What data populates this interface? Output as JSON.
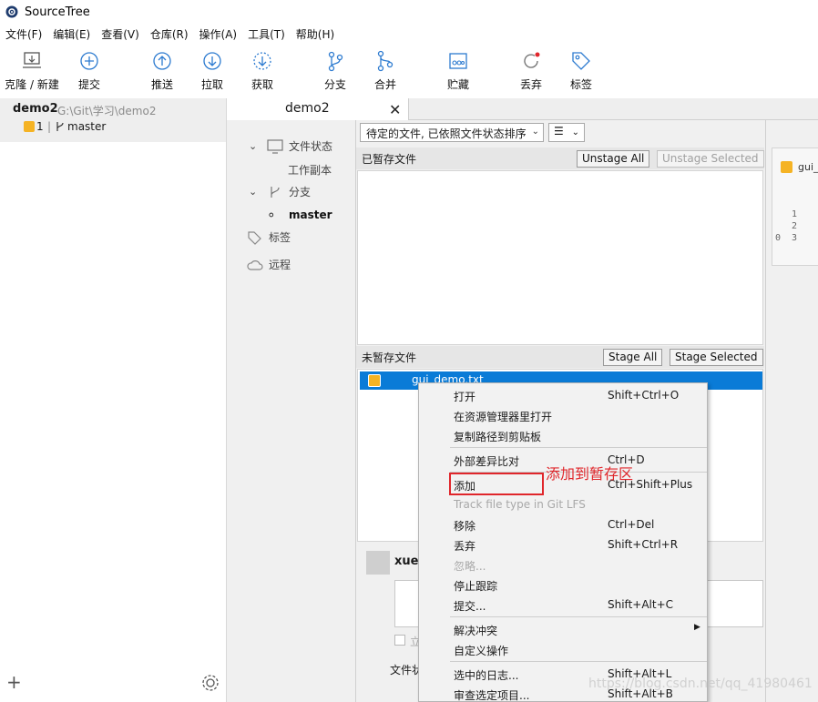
{
  "window": {
    "title": "SourceTree"
  },
  "menu": [
    "文件(F)",
    "编辑(E)",
    "查看(V)",
    "仓库(R)",
    "操作(A)",
    "工具(T)",
    "帮助(H)"
  ],
  "toolbar": {
    "clone": "克隆 / 新建",
    "commit": "提交",
    "push": "推送",
    "pull": "拉取",
    "fetch": "获取",
    "branch": "分支",
    "merge": "合并",
    "stash": "贮藏",
    "discard": "丢弃",
    "tag": "标签"
  },
  "repo": {
    "name": "demo2",
    "path": "G:\\Git\\学习\\demo2",
    "badge_count": "1",
    "separator": "|",
    "branch": "master"
  },
  "tab": {
    "label": "demo2",
    "close": "✕"
  },
  "sidebar": {
    "file_status": "文件状态",
    "working_copy": "工作副本",
    "branches": "分支",
    "current_branch": "master",
    "tags": "标签",
    "remotes": "远程"
  },
  "center": {
    "sort_dropdown": "待定的文件, 已依照文件状态排序",
    "view_button": "☰",
    "staged_label": "已暂存文件",
    "unstage_all": "Unstage All",
    "unstage_selected": "Unstage Selected",
    "unstaged_label": "未暂存文件",
    "stage_all": "Stage All",
    "stage_selected": "Stage Selected",
    "file_name": "gui_demo.txt"
  },
  "commit": {
    "user": "xue",
    "checkbox_label": "立",
    "files_label": "文件状"
  },
  "right_panel": {
    "file_name": "gui_",
    "lines": [
      "   1",
      "   2",
      "0  3"
    ]
  },
  "context_menu": {
    "items": [
      {
        "label": "打开",
        "shortcut": "Shift+Ctrl+O"
      },
      {
        "label": "在资源管理器里打开",
        "shortcut": ""
      },
      {
        "label": "复制路径到剪贴板",
        "shortcut": ""
      },
      {
        "label": "外部差异比对",
        "shortcut": "Ctrl+D"
      },
      {
        "label": "添加",
        "shortcut": "Ctrl+Shift+Plus"
      },
      {
        "label": "Track file type in Git LFS",
        "shortcut": ""
      },
      {
        "label": "移除",
        "shortcut": "Ctrl+Del"
      },
      {
        "label": "丢弃",
        "shortcut": "Shift+Ctrl+R"
      },
      {
        "label": "忽略...",
        "shortcut": ""
      },
      {
        "label": "停止跟踪",
        "shortcut": ""
      },
      {
        "label": "提交...",
        "shortcut": "Shift+Alt+C"
      },
      {
        "label": "解决冲突",
        "shortcut": ""
      },
      {
        "label": "自定义操作",
        "shortcut": ""
      },
      {
        "label": "选中的日志...",
        "shortcut": "Shift+Alt+L"
      },
      {
        "label": "审查选定项目...",
        "shortcut": "Shift+Alt+B"
      }
    ]
  },
  "annotation": "添加到暂存区",
  "watermark": "https://blog.csdn.net/qq_41980461",
  "colors": {
    "selection": "#0a7bd7",
    "badge": "#f5b324",
    "annotation": "#e0262b"
  }
}
